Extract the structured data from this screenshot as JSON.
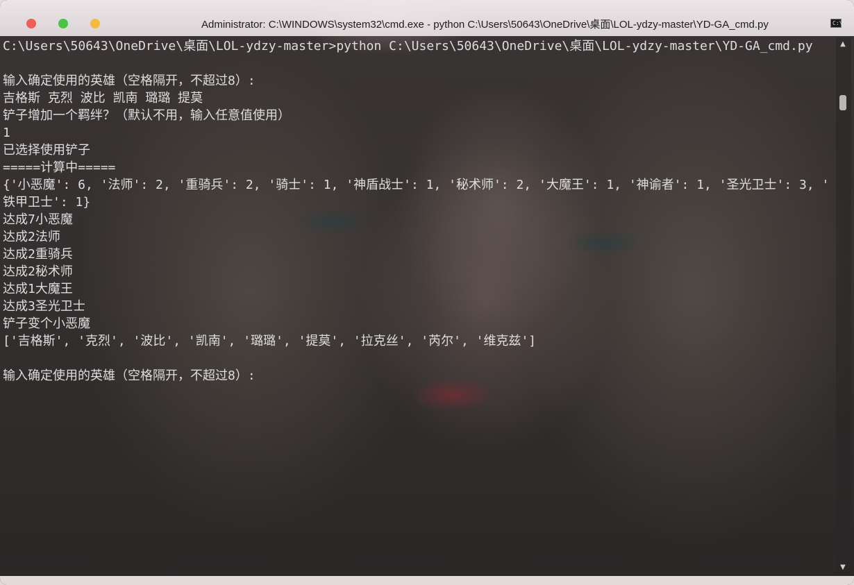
{
  "window": {
    "title": "Administrator: C:\\WINDOWS\\system32\\cmd.exe - python  C:\\Users\\50643\\OneDrive\\桌面\\LOL-ydzy-master\\YD-GA_cmd.py",
    "app_icon": "cmd-icon",
    "controls": [
      "close",
      "maximize",
      "minimize"
    ]
  },
  "console": {
    "lines": [
      "C:\\Users\\50643\\OneDrive\\桌面\\LOL-ydzy-master>python C:\\Users\\50643\\OneDrive\\桌面\\LOL-ydzy-master\\YD-GA_cmd.py",
      "",
      "输入确定使用的英雄（空格隔开，不超过8）:",
      "吉格斯 克烈 波比 凯南 璐璐 提莫",
      "铲子增加一个羁绊？（默认不用，输入任意值使用）",
      "1",
      "已选择使用铲子",
      "=====计算中=====",
      "{'小恶魔': 6, '法师': 2, '重骑兵': 2, '骑士': 1, '神盾战士': 1, '秘术师': 2, '大魔王': 1, '神谕者': 1, '圣光卫士': 3, '",
      "铁甲卫士': 1}",
      "达成7小恶魔",
      "达成2法师",
      "达成2重骑兵",
      "达成2秘术师",
      "达成1大魔王",
      "达成3圣光卫士",
      "铲子变个小恶魔",
      "['吉格斯', '克烈', '波比', '凯南', '璐璐', '提莫', '拉克丝', '芮尔', '维克兹']",
      "",
      "输入确定使用的英雄（空格隔开，不超过8）:"
    ]
  },
  "colors": {
    "close": "#ee5f5a",
    "maximize": "#49c445",
    "minimize": "#f4bc3f",
    "text": "#dedede"
  }
}
